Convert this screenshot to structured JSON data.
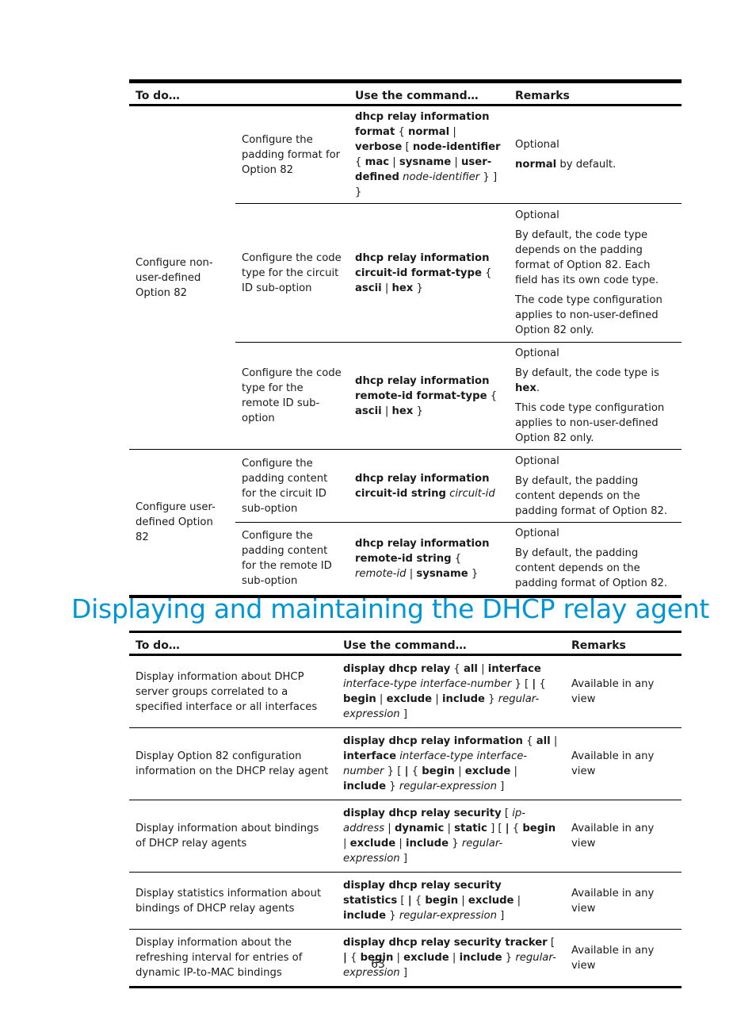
{
  "table1": {
    "headers": [
      "To do…",
      "Use the command…",
      "Remarks"
    ],
    "groups": [
      {
        "label": "Configure non-user-defined Option 82",
        "rows": [
          {
            "task": "Configure the padding format for Option 82",
            "command": [
              {
                "t": "dhcp relay information format",
                "s": "b"
              },
              {
                "t": " { ",
                "s": "n"
              },
              {
                "t": "normal",
                "s": "b"
              },
              {
                "t": " | ",
                "s": "n"
              },
              {
                "t": "verbose",
                "s": "b"
              },
              {
                "t": " [ ",
                "s": "n"
              },
              {
                "t": "node-identifier",
                "s": "b"
              },
              {
                "t": " { ",
                "s": "n"
              },
              {
                "t": "mac",
                "s": "b"
              },
              {
                "t": " | ",
                "s": "n"
              },
              {
                "t": "sysname",
                "s": "b"
              },
              {
                "t": " | ",
                "s": "n"
              },
              {
                "t": "user-defined",
                "s": "b"
              },
              {
                "t": " ",
                "s": "n"
              },
              {
                "t": "node-identifier",
                "s": "i"
              },
              {
                "t": " } ] }",
                "s": "n"
              }
            ],
            "remarks": [
              [
                {
                  "t": "Optional",
                  "s": "n"
                }
              ],
              [
                {
                  "t": "normal",
                  "s": "b"
                },
                {
                  "t": " by default.",
                  "s": "n"
                }
              ]
            ]
          },
          {
            "task": "Configure the code type for the circuit ID sub-option",
            "command": [
              {
                "t": "dhcp relay information circuit-id format-type",
                "s": "b"
              },
              {
                "t": " { ",
                "s": "n"
              },
              {
                "t": "ascii",
                "s": "b"
              },
              {
                "t": " | ",
                "s": "n"
              },
              {
                "t": "hex",
                "s": "b"
              },
              {
                "t": " }",
                "s": "n"
              }
            ],
            "remarks": [
              [
                {
                  "t": "Optional",
                  "s": "n"
                }
              ],
              [
                {
                  "t": "By default, the code type depends on the padding format of Option 82. Each field has its own code type.",
                  "s": "n"
                }
              ],
              [
                {
                  "t": "The code type configuration applies to non-user-defined Option 82 only.",
                  "s": "n"
                }
              ]
            ]
          },
          {
            "task": "Configure the code type for the remote ID sub-option",
            "command": [
              {
                "t": "dhcp relay information remote-id format-type",
                "s": "b"
              },
              {
                "t": " { ",
                "s": "n"
              },
              {
                "t": "ascii",
                "s": "b"
              },
              {
                "t": " | ",
                "s": "n"
              },
              {
                "t": "hex",
                "s": "b"
              },
              {
                "t": " }",
                "s": "n"
              }
            ],
            "remarks": [
              [
                {
                  "t": "Optional",
                  "s": "n"
                }
              ],
              [
                {
                  "t": "By default, the code type is ",
                  "s": "n"
                },
                {
                  "t": "hex",
                  "s": "b"
                },
                {
                  "t": ".",
                  "s": "n"
                }
              ],
              [
                {
                  "t": "This code type configuration applies to non-user-defined Option 82 only.",
                  "s": "n"
                }
              ]
            ]
          }
        ]
      },
      {
        "label": "Configure user-defined Option 82",
        "rows": [
          {
            "task": "Configure the padding content for the circuit ID sub-option",
            "command": [
              {
                "t": "dhcp relay information circuit-id string",
                "s": "b"
              },
              {
                "t": " ",
                "s": "n"
              },
              {
                "t": "circuit-id",
                "s": "i"
              }
            ],
            "remarks": [
              [
                {
                  "t": "Optional",
                  "s": "n"
                }
              ],
              [
                {
                  "t": "By default, the padding content depends on the padding format of Option 82.",
                  "s": "n"
                }
              ]
            ]
          },
          {
            "task": "Configure the padding content for the remote ID sub-option",
            "command": [
              {
                "t": "dhcp relay information remote-id string",
                "s": "b"
              },
              {
                "t": " { ",
                "s": "n"
              },
              {
                "t": "remote-id",
                "s": "i"
              },
              {
                "t": " | ",
                "s": "n"
              },
              {
                "t": "sysname",
                "s": "b"
              },
              {
                "t": " }",
                "s": "n"
              }
            ],
            "remarks": [
              [
                {
                  "t": "Optional",
                  "s": "n"
                }
              ],
              [
                {
                  "t": "By default, the padding content depends on the padding format of Option 82.",
                  "s": "n"
                }
              ]
            ]
          }
        ]
      }
    ]
  },
  "section_heading": "Displaying and maintaining the DHCP relay agent",
  "table2": {
    "headers": [
      "To do…",
      "Use the command…",
      "Remarks"
    ],
    "rows": [
      {
        "task": "Display information about DHCP server groups correlated to a specified interface or all interfaces",
        "command": [
          {
            "t": "display dhcp relay",
            "s": "b"
          },
          {
            "t": " { ",
            "s": "n"
          },
          {
            "t": "all",
            "s": "b"
          },
          {
            "t": " | ",
            "s": "n"
          },
          {
            "t": "interface",
            "s": "b"
          },
          {
            "t": " ",
            "s": "n"
          },
          {
            "t": "interface-type interface-number",
            "s": "i"
          },
          {
            "t": " } [ ",
            "s": "n"
          },
          {
            "t": "|",
            "s": "b"
          },
          {
            "t": " { ",
            "s": "n"
          },
          {
            "t": "begin",
            "s": "b"
          },
          {
            "t": " | ",
            "s": "n"
          },
          {
            "t": "exclude",
            "s": "b"
          },
          {
            "t": " | ",
            "s": "n"
          },
          {
            "t": "include",
            "s": "b"
          },
          {
            "t": " } ",
            "s": "n"
          },
          {
            "t": "regular-expression",
            "s": "i"
          },
          {
            "t": " ]",
            "s": "n"
          }
        ],
        "remarks": "Available in any view"
      },
      {
        "task": "Display Option 82 configuration information on the DHCP relay agent",
        "command": [
          {
            "t": "display dhcp relay information",
            "s": "b"
          },
          {
            "t": " { ",
            "s": "n"
          },
          {
            "t": "all",
            "s": "b"
          },
          {
            "t": " | ",
            "s": "n"
          },
          {
            "t": "interface",
            "s": "b"
          },
          {
            "t": " ",
            "s": "n"
          },
          {
            "t": "interface-type interface-number",
            "s": "i"
          },
          {
            "t": " } [ ",
            "s": "n"
          },
          {
            "t": "|",
            "s": "b"
          },
          {
            "t": " { ",
            "s": "n"
          },
          {
            "t": "begin",
            "s": "b"
          },
          {
            "t": " | ",
            "s": "n"
          },
          {
            "t": "exclude",
            "s": "b"
          },
          {
            "t": " | ",
            "s": "n"
          },
          {
            "t": "include",
            "s": "b"
          },
          {
            "t": " } ",
            "s": "n"
          },
          {
            "t": "regular-expression",
            "s": "i"
          },
          {
            "t": " ]",
            "s": "n"
          }
        ],
        "remarks": "Available in any view"
      },
      {
        "task": "Display information about bindings of DHCP relay agents",
        "command": [
          {
            "t": "display dhcp relay security",
            "s": "b"
          },
          {
            "t": " [ ",
            "s": "n"
          },
          {
            "t": "ip-address",
            "s": "i"
          },
          {
            "t": " | ",
            "s": "n"
          },
          {
            "t": "dynamic",
            "s": "b"
          },
          {
            "t": " | ",
            "s": "n"
          },
          {
            "t": "static",
            "s": "b"
          },
          {
            "t": " ] [ ",
            "s": "n"
          },
          {
            "t": "|",
            "s": "b"
          },
          {
            "t": " { ",
            "s": "n"
          },
          {
            "t": "begin",
            "s": "b"
          },
          {
            "t": " | ",
            "s": "n"
          },
          {
            "t": "exclude",
            "s": "b"
          },
          {
            "t": " | ",
            "s": "n"
          },
          {
            "t": "include",
            "s": "b"
          },
          {
            "t": " } ",
            "s": "n"
          },
          {
            "t": "regular-expression",
            "s": "i"
          },
          {
            "t": " ]",
            "s": "n"
          }
        ],
        "remarks": "Available in any view"
      },
      {
        "task": "Display statistics information about bindings of DHCP relay agents",
        "command": [
          {
            "t": "display dhcp relay security statistics",
            "s": "b"
          },
          {
            "t": " [ ",
            "s": "n"
          },
          {
            "t": "|",
            "s": "b"
          },
          {
            "t": " { ",
            "s": "n"
          },
          {
            "t": "begin",
            "s": "b"
          },
          {
            "t": " | ",
            "s": "n"
          },
          {
            "t": "exclude",
            "s": "b"
          },
          {
            "t": " | ",
            "s": "n"
          },
          {
            "t": "include",
            "s": "b"
          },
          {
            "t": " } ",
            "s": "n"
          },
          {
            "t": "regular-expression",
            "s": "i"
          },
          {
            "t": " ]",
            "s": "n"
          }
        ],
        "remarks": "Available in any view"
      },
      {
        "task": "Display information about the refreshing interval for entries of dynamic IP-to-MAC bindings",
        "command": [
          {
            "t": "display dhcp relay security tracker",
            "s": "b"
          },
          {
            "t": " [ ",
            "s": "n"
          },
          {
            "t": "|",
            "s": "b"
          },
          {
            "t": " { ",
            "s": "n"
          },
          {
            "t": "begin",
            "s": "b"
          },
          {
            "t": " | ",
            "s": "n"
          },
          {
            "t": "exclude",
            "s": "b"
          },
          {
            "t": " | ",
            "s": "n"
          },
          {
            "t": "include",
            "s": "b"
          },
          {
            "t": " } ",
            "s": "n"
          },
          {
            "t": "regular-expression",
            "s": "i"
          },
          {
            "t": " ]",
            "s": "n"
          }
        ],
        "remarks": "Available in any view"
      }
    ]
  },
  "page_number": "63"
}
